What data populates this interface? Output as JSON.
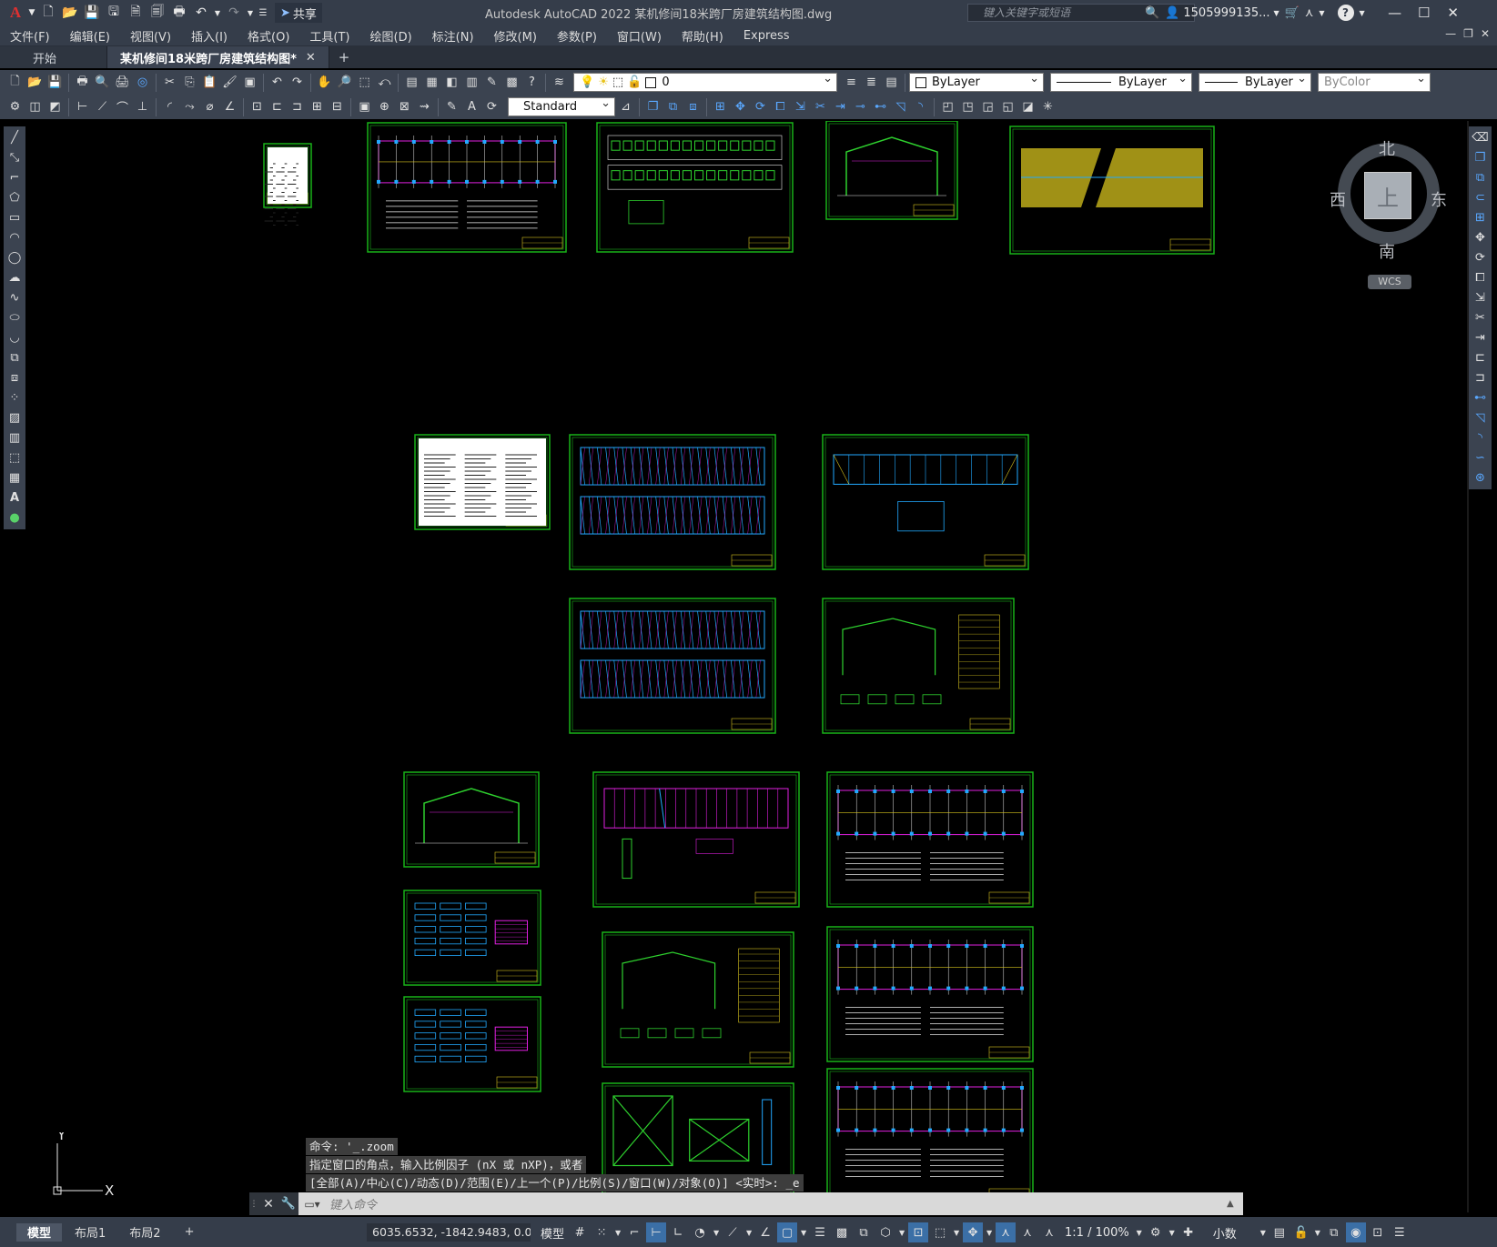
{
  "app": {
    "title": "Autodesk AutoCAD 2022    某机修间18米跨厂房建筑结构图.dwg",
    "share_label": "共享",
    "search_placeholder": "键入关键字或短语",
    "user_name": "1505999135...",
    "help_label": "?"
  },
  "menu": [
    "文件(F)",
    "编辑(E)",
    "视图(V)",
    "插入(I)",
    "格式(O)",
    "工具(T)",
    "绘图(D)",
    "标注(N)",
    "修改(M)",
    "参数(P)",
    "窗口(W)",
    "帮助(H)",
    "Express"
  ],
  "tabs": {
    "start": "开始",
    "document": "某机修间18米跨厂房建筑结构图*",
    "close": "✕",
    "new": "+"
  },
  "properties": {
    "layer": "0",
    "color": "ByLayer",
    "linetype": "ByLayer",
    "lineweight": "ByLayer",
    "plotstyle": "ByColor",
    "textstyle": "Standard"
  },
  "viewcube": {
    "face": "上",
    "north": "北",
    "south": "南",
    "east": "东",
    "west": "西",
    "wcs": "WCS"
  },
  "ucs": {
    "x": "X",
    "y": "Y"
  },
  "command": {
    "history": [
      "命令: '_.zoom",
      "指定窗口的角点，输入比例因子 (nX 或 nXP)，或者",
      "[全部(A)/中心(C)/动态(D)/范围(E)/上一个(P)/比例(S)/窗口(W)/对象(O)] <实时>: _e"
    ],
    "placeholder": "键入命令"
  },
  "status": {
    "layout_tabs": [
      "模型",
      "布局1",
      "布局2"
    ],
    "add_layout": "+",
    "coordinates": "6035.6532, -1842.9483, 0.00...",
    "model_label": "模型",
    "scale": "1:1 / 100%",
    "units": "小数"
  },
  "colors": {
    "titlebar": "#353d4a",
    "toolbar": "#3b4350",
    "canvas": "#000000",
    "frame": "#19b219",
    "magenta": "#e020e0",
    "cyan": "#22a9ff",
    "yellow": "#d6c21e",
    "white": "#e8e8e8"
  }
}
